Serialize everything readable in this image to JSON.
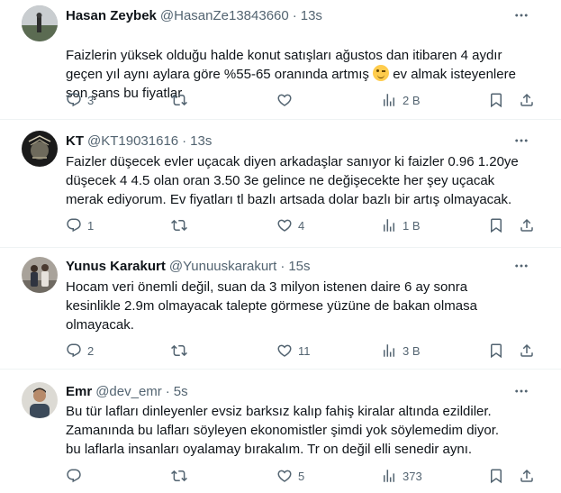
{
  "tweets": [
    {
      "name": "Hasan Zeybek",
      "handle": "@HasanZe13843660",
      "sep": "·",
      "time": "13s",
      "text_before": "Faizlerin yüksek olduğu halde konut satışları ağustos dan itibaren 4 aydır\ngeçen yıl aynı aylara göre %55-65 oranında artmış ",
      "text_after": " ev almak isteyenlere\nson şans bu fiyatlar",
      "emoji": "winking-face",
      "replies": "3",
      "reposts": "",
      "likes": "",
      "views": "2 B"
    },
    {
      "name": "KT",
      "handle": "@KT19031616",
      "sep": "·",
      "time": "13s",
      "text": "Faizler düşecek evler uçacak diyen arkadaşlar sanıyor ki faizler 0.96 1.20ye\ndüşecek 4 4.5 olan oran 3.50 3e gelince ne değişecekte her şey uçacak\nmerak ediyorum. Ev fiyatları tl bazlı artsada dolar bazlı bir artış olmayacak.",
      "replies": "1",
      "reposts": "",
      "likes": "4",
      "views": "1 B"
    },
    {
      "name": "Yunus Karakurt",
      "handle": "@Yunuuskarakurt",
      "sep": "·",
      "time": "15s",
      "text": "Hocam veri önemli değil, suan da 3 milyon istenen daire 6 ay sonra\nkesinlikle 2.9m olmayacak talepte görmese yüzüne de bakan olmasa\nolmayacak.",
      "replies": "2",
      "reposts": "",
      "likes": "11",
      "views": "3 B"
    },
    {
      "name": "Emr",
      "handle": "@dev_emr",
      "sep": "·",
      "time": "5s",
      "text": "Bu tür lafları dinleyenler evsiz barksız kalıp fahiş kiralar altında ezildiler.\nZamanında bu lafları söyleyen ekonomistler şimdi yok söylemedim diyor.\nbu laflarla insanları oyalamay bırakalım. Tr on değil elli senedir aynı.",
      "replies": "",
      "reposts": "",
      "likes": "5",
      "views": "373"
    }
  ],
  "icons": {
    "reply": "reply-icon",
    "repost": "repost-icon",
    "like": "like-icon",
    "views": "views-icon",
    "bookmark": "bookmark-icon",
    "share": "share-icon",
    "more": "more-icon"
  },
  "colors": {
    "text": "#0f1419",
    "muted": "#536471",
    "divider": "#eff3f4"
  }
}
